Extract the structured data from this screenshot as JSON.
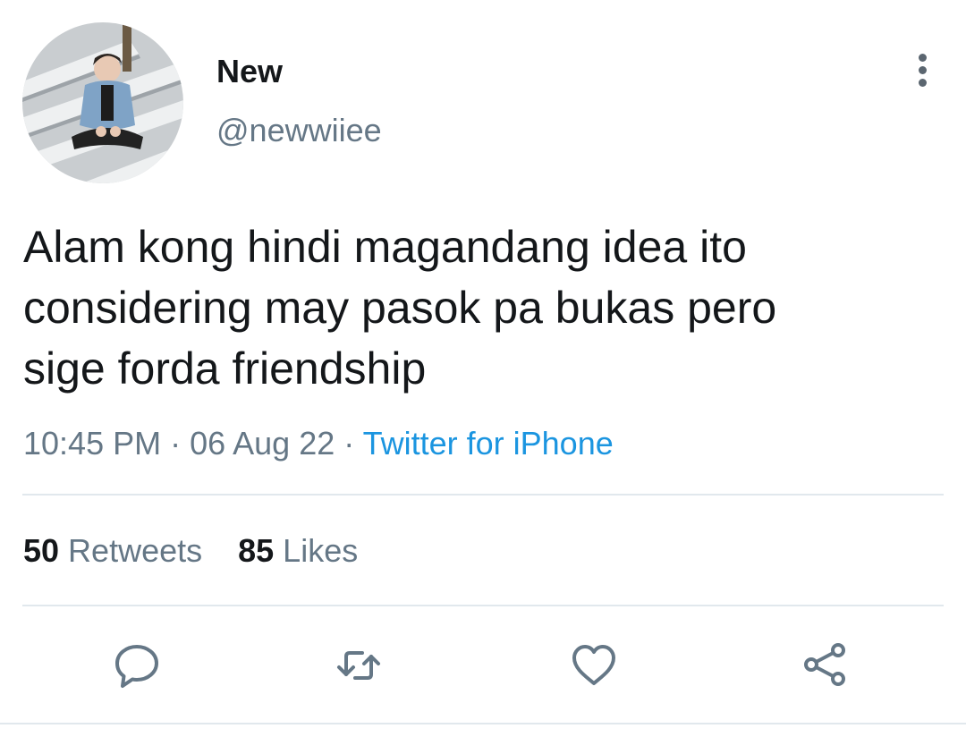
{
  "tweet": {
    "author": {
      "display_name": "New",
      "handle": "@newwiiee",
      "avatar_icon": "profile-photo"
    },
    "text_lines": [
      "Alam kong hindi magandang idea ito",
      "considering may pasok pa bukas pero",
      "sige forda friendship"
    ],
    "time": "10:45 PM",
    "separator": " · ",
    "date": "06 Aug 22",
    "source": "Twitter for iPhone",
    "stats": {
      "retweets_count": "50",
      "retweets_label": " Retweets",
      "likes_count": "85",
      "likes_label": " Likes"
    },
    "actions": [
      "reply-icon",
      "retweet-icon",
      "like-icon",
      "share-icon"
    ]
  },
  "colors": {
    "text": "#14171a",
    "secondary": "#657786",
    "link": "#1b95e0",
    "divider": "#e1e8ed",
    "icon": "#657786"
  }
}
